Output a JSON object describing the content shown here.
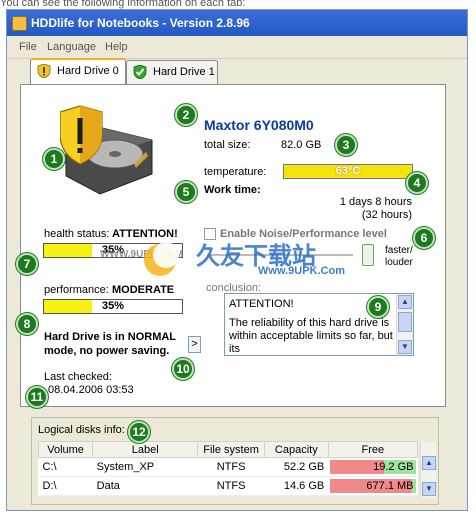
{
  "top_cropped_text": "You can see the following information on each tab:",
  "window": {
    "title": "HDDlife for Notebooks - Version 2.8.96"
  },
  "menu": [
    "File",
    "Language",
    "Help"
  ],
  "tabs": [
    {
      "label": "Hard Drive 0",
      "active": true,
      "icon": "warning-shield-icon"
    },
    {
      "label": "Hard Drive 1",
      "active": false,
      "icon": "ok-shield-icon"
    }
  ],
  "drive": {
    "model": "Maxtor 6Y080M0",
    "total_size_label": "total size:",
    "total_size": "82.0 GB",
    "temperature_label": "temperature:",
    "temperature_value": "63°C",
    "work_time_label": "Work time:",
    "work_time_line1": "1 days 8 hours",
    "work_time_line2": "(32 hours)"
  },
  "health": {
    "label": "health status:",
    "status": "ATTENTION!",
    "value": "35%",
    "percent": 35
  },
  "performance": {
    "label": "performance:",
    "status": "MODERATE",
    "value": "35%",
    "percent": 35
  },
  "noise": {
    "checkbox_label": "Enable Noise/Performance level",
    "right_label_1": "faster/",
    "right_label_2": "louder"
  },
  "power_mode_line1": "Hard Drive is in NORMAL",
  "power_mode_line2": "mode, no power saving.",
  "expand_button": ">",
  "conclusion": {
    "label": "conclusion:",
    "heading": "ATTENTION!",
    "text": "The reliability of this hard drive is within acceptable limits so far, but its"
  },
  "last_checked": {
    "label": "Last checked:",
    "value": "08.04.2006 03:53"
  },
  "logical_disks": {
    "label": "Logical disks info:",
    "columns": [
      "Volume",
      "Label",
      "File system",
      "Capacity",
      "Free"
    ],
    "rows": [
      {
        "volume": "C:\\",
        "label": "System_XP",
        "fs": "NTFS",
        "capacity": "52.2 GB",
        "free": "19.2 GB",
        "free_fraction": 0.37
      },
      {
        "volume": "D:\\",
        "label": "Data",
        "fs": "NTFS",
        "capacity": "14.6 GB",
        "free": "677.1 MB",
        "free_fraction": 0.05
      }
    ]
  },
  "callouts": [
    "1",
    "2",
    "3",
    "4",
    "5",
    "6",
    "7",
    "8",
    "9",
    "10",
    "11",
    "12"
  ],
  "watermark": {
    "brand": "久友下载站",
    "url_left": "WWW.9UPK.COM",
    "url_right": "Www.9UPK.Com"
  },
  "colors": {
    "bar_fill": "#f6f211",
    "temp_fill": "#f6e30e",
    "callout_green": "#1f7a1f",
    "model_blue": "#0b3a9e",
    "free_red": "#f08a8a",
    "free_green": "#9ee39e"
  }
}
